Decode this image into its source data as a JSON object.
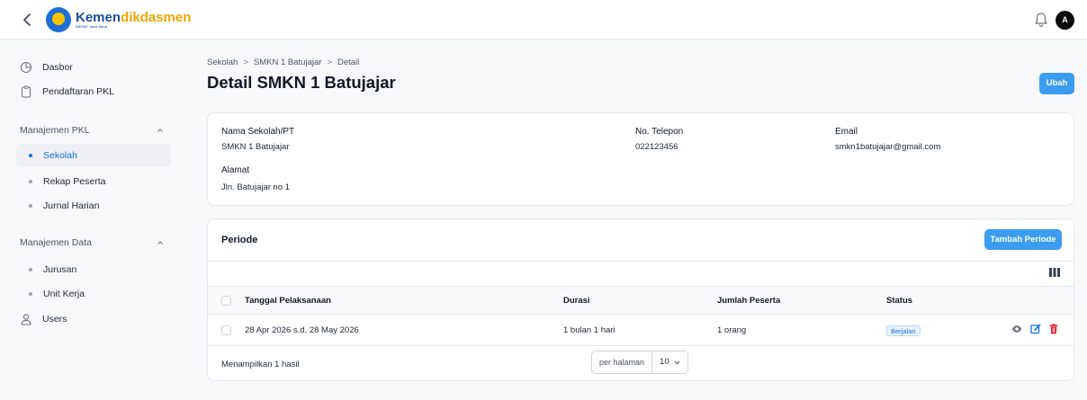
{
  "app": {
    "logo_name_part1": "Kemen",
    "logo_name_part2": "dikdasmen",
    "logo_subtitle": "BBPMP Jawa Barat",
    "avatar_initial": "A"
  },
  "sidebar": {
    "items": [
      {
        "label": "Dasbor",
        "icon": "dashboard-icon"
      },
      {
        "label": "Pendaftaran PKL",
        "icon": "clipboard-icon"
      }
    ],
    "groups": [
      {
        "label": "Manajemen PKL",
        "items": [
          {
            "label": "Sekolah",
            "active": true
          },
          {
            "label": "Rekap Peserta",
            "active": false
          },
          {
            "label": "Jurnal Harian",
            "active": false
          }
        ]
      },
      {
        "label": "Manajemen Data",
        "items": [
          {
            "label": "Jurusan",
            "active": false
          },
          {
            "label": "Unit Kerja",
            "active": false
          }
        ]
      }
    ],
    "users_label": "Users"
  },
  "breadcrumb": [
    "Sekolah",
    "SMKN 1 Batujajar",
    "Detail"
  ],
  "page": {
    "title": "Detail SMKN 1 Batujajar",
    "edit_button": "Ubah"
  },
  "school": {
    "name_label": "Nama Sekolah/PT",
    "name_value": "SMKN 1 Batujajar",
    "phone_label": "No. Telepon",
    "phone_value": "022123456",
    "email_label": "Email",
    "email_value": "smkn1batujajar@gmail.com",
    "address_label": "Alamat",
    "address_value": "Jln. Batujajar no 1"
  },
  "periode": {
    "title": "Periode",
    "add_button": "Tambah Periode",
    "columns": [
      "Tanggal Pelaksanaan",
      "Durasi",
      "Jumlah Peserta",
      "Status"
    ],
    "rows": [
      {
        "tanggal": "28 Apr 2026 s.d. 28 May 2026",
        "durasi": "1 bulan 1 hari",
        "jumlah": "1 orang",
        "status": "Berjalan"
      }
    ],
    "footer_text": "Menampilkan 1 hasil",
    "per_page_label": "per halaman",
    "per_page_value": "10"
  },
  "colors": {
    "primary": "#3b9cf0",
    "active_nav": "#1570d8",
    "view_icon": "#6b7280",
    "edit_icon": "#1570d8",
    "delete_icon": "#e11d2e"
  }
}
